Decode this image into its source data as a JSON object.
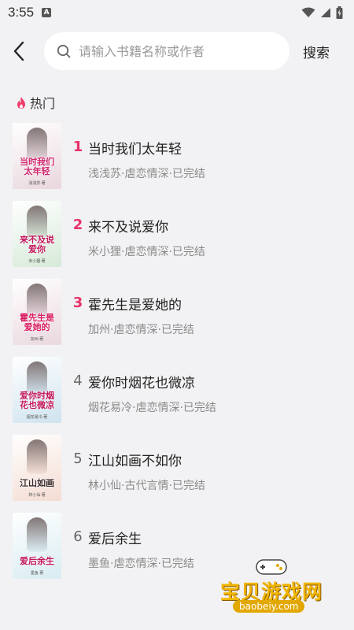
{
  "status": {
    "time": "3:55",
    "app_badge": "A"
  },
  "search": {
    "placeholder": "请输入书籍名称或作者",
    "button_label": "搜索"
  },
  "section": {
    "title": "热门"
  },
  "books": [
    {
      "rank": "1",
      "title": "当时我们太年轻",
      "meta": "浅浅苏·虐恋情深·已完结",
      "cover_text": "当时我们太年轻",
      "cover_author": "浅浅苏·著",
      "cover_color": "#e9d7de",
      "title_color": "#d0266e"
    },
    {
      "rank": "2",
      "title": "来不及说爱你",
      "meta": "米小狸·虐恋情深·已完结",
      "cover_text": "来不及说爱你",
      "cover_author": "米小狸·著",
      "cover_color": "#d6ead9",
      "title_color": "#c2185b"
    },
    {
      "rank": "3",
      "title": "霍先生是爱她的",
      "meta": "加州·虐恋情深·已完结",
      "cover_text": "霍先生是爱她的",
      "cover_author": "加州·著",
      "cover_color": "#ead8df",
      "title_color": "#d81b60"
    },
    {
      "rank": "4",
      "title": "爱你时烟花也微凉",
      "meta": "烟花易冷·虐恋情深·已完结",
      "cover_text": "爱你时烟花也微凉",
      "cover_author": "烟花易冷·著",
      "cover_color": "#cfe3ef",
      "title_color": "#c2185b"
    },
    {
      "rank": "5",
      "title": "江山如画不如你",
      "meta": "林小仙·古代言情·已完结",
      "cover_text": "江山如画",
      "cover_author": "林小仙·著",
      "cover_color": "#f4dcd2",
      "title_color": "#3a2a2a"
    },
    {
      "rank": "6",
      "title": "爱后余生",
      "meta": "墨鱼·虐恋情深·已完结",
      "cover_text": "爱后余生",
      "cover_author": "墨鱼·著",
      "cover_color": "#d8ecf2",
      "title_color": "#c2185b"
    }
  ],
  "watermark": {
    "text": "宝贝游戏网",
    "url": "baobeiy.com"
  },
  "colors": {
    "accent": "#e8336a",
    "background": "#f2f2f4",
    "meta": "#8a8a8a"
  }
}
